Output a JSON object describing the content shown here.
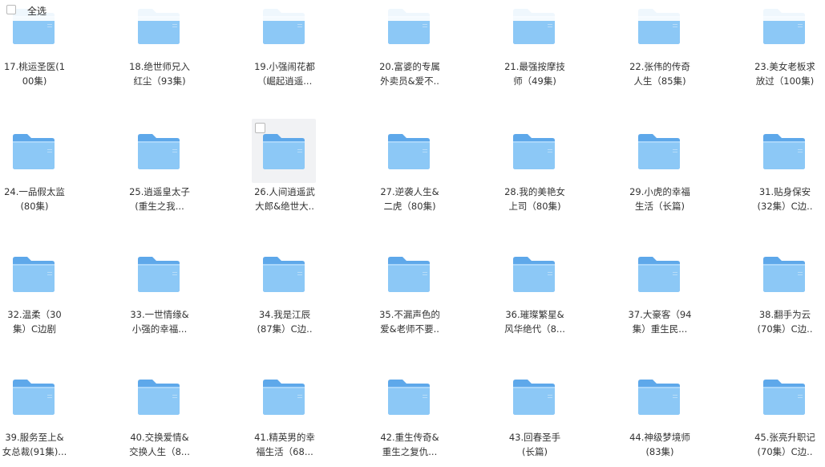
{
  "header": {
    "select_all_label": "全选"
  },
  "rows": [
    [
      {
        "name_l1": "17.桃运圣医(1",
        "name_l2": "00集)"
      },
      {
        "name_l1": "18.绝世师兄入",
        "name_l2": "红尘（93集)"
      },
      {
        "name_l1": "19.小强闹花都",
        "name_l2": "（崛起逍遥..."
      },
      {
        "name_l1": "20.富婆的专属",
        "name_l2": "外卖员&爱不.."
      },
      {
        "name_l1": "21.最强按摩技",
        "name_l2": "师（49集)"
      },
      {
        "name_l1": "22.张伟的传奇",
        "name_l2": "人生（85集)"
      },
      {
        "name_l1": "23.美女老板求",
        "name_l2": "放过（100集)"
      }
    ],
    [
      {
        "name_l1": "24.一品假太监",
        "name_l2": "(80集)"
      },
      {
        "name_l1": "25.逍遥皇太子",
        "name_l2": "(重生之我..."
      },
      {
        "name_l1": "26.人间逍遥武",
        "name_l2": "大郎&绝世大.."
      },
      {
        "name_l1": "27.逆袭人生&",
        "name_l2": "二虎（80集)"
      },
      {
        "name_l1": "28.我的美艳女",
        "name_l2": "上司（80集)"
      },
      {
        "name_l1": "29.小虎的幸福",
        "name_l2": "生活（长篇)"
      },
      {
        "name_l1": "31.贴身保安",
        "name_l2": "(32集）C边.."
      }
    ],
    [
      {
        "name_l1": "32.温柔（30",
        "name_l2": "集）C边剧"
      },
      {
        "name_l1": "33.一世情缘&",
        "name_l2": "小强的幸福..."
      },
      {
        "name_l1": "34.我是江辰",
        "name_l2": "(87集）C边.."
      },
      {
        "name_l1": "35.不漏声色的",
        "name_l2": "爱&老师不要.."
      },
      {
        "name_l1": "36.璀璨繁星&",
        "name_l2": "风华绝代（8..."
      },
      {
        "name_l1": "37.大豪客（94",
        "name_l2": "集）重生民..."
      },
      {
        "name_l1": "38.翻手为云",
        "name_l2": "(70集）C边.."
      }
    ],
    [
      {
        "name_l1": "39.服务至上&",
        "name_l2": "女总裁(91集)..."
      },
      {
        "name_l1": "40.交换爱情&",
        "name_l2": "交换人生（8..."
      },
      {
        "name_l1": "41.精英男的幸",
        "name_l2": "福生活（68..."
      },
      {
        "name_l1": "42.重生传奇&",
        "name_l2": "重生之复仇..."
      },
      {
        "name_l1": "43.回春圣手",
        "name_l2": "(长篇)"
      },
      {
        "name_l1": "44.神级梦境师",
        "name_l2": "(83集)"
      },
      {
        "name_l1": "45.张亮升职记",
        "name_l2": "(70集）C边.."
      }
    ]
  ],
  "colors": {
    "folder_back": "#5ea8ea",
    "folder_front": "#8cc8f6",
    "folder_front_top": "#a9d6fa",
    "text": "#333333"
  },
  "icons": {
    "folder": "folder-icon",
    "checkbox": "checkbox-icon"
  }
}
